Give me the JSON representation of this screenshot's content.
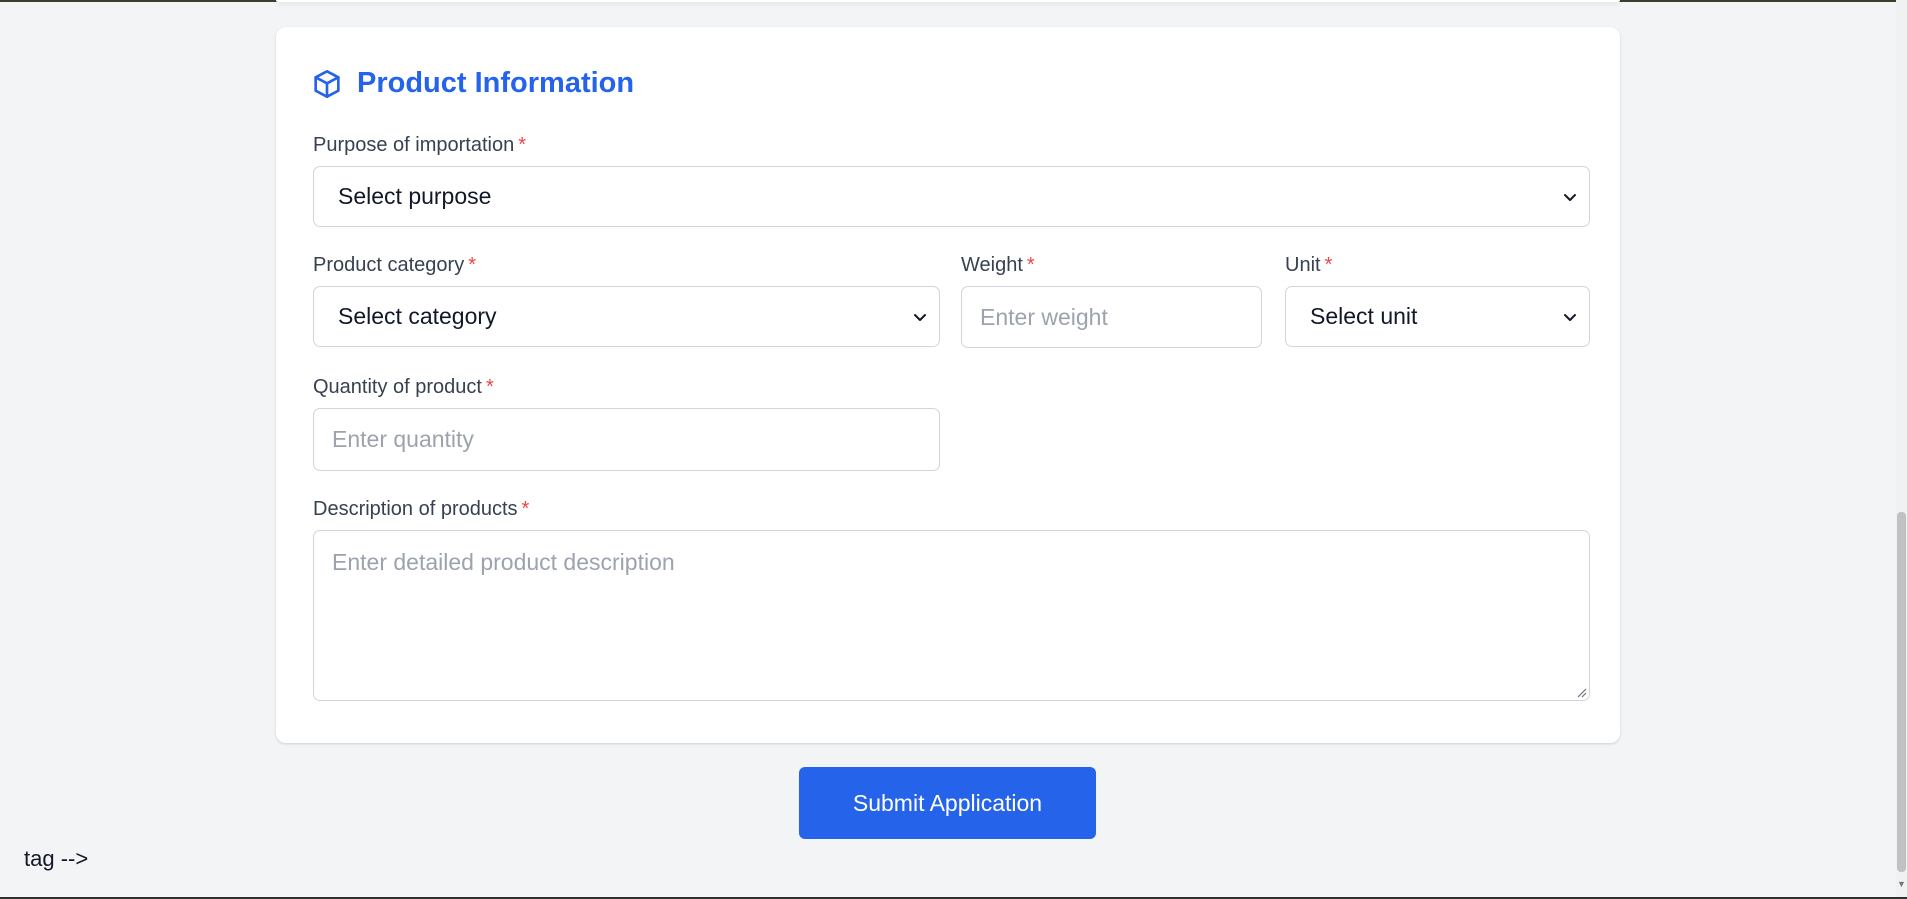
{
  "section": {
    "title": "Product Information",
    "icon": "package-icon",
    "accent_color": "#2563eb"
  },
  "fields": {
    "purpose": {
      "label": "Purpose of importation",
      "required": "*",
      "selected": "Select purpose"
    },
    "category": {
      "label": "Product category",
      "required": "*",
      "selected": "Select category"
    },
    "weight": {
      "label": "Weight",
      "required": "*",
      "placeholder": "Enter weight"
    },
    "unit": {
      "label": "Unit",
      "required": "*",
      "selected": "Select unit"
    },
    "quantity": {
      "label": "Quantity of product",
      "required": "*",
      "placeholder": "Enter quantity"
    },
    "description": {
      "label": "Description of products",
      "required": "*",
      "placeholder": "Enter detailed product description"
    }
  },
  "submit": {
    "label": "Submit Application",
    "color": "#2563eb"
  },
  "stray": {
    "text": "tag -->"
  },
  "colors": {
    "required": "#ef4444",
    "background": "#f3f4f6",
    "placeholder": "#9ca3af"
  }
}
